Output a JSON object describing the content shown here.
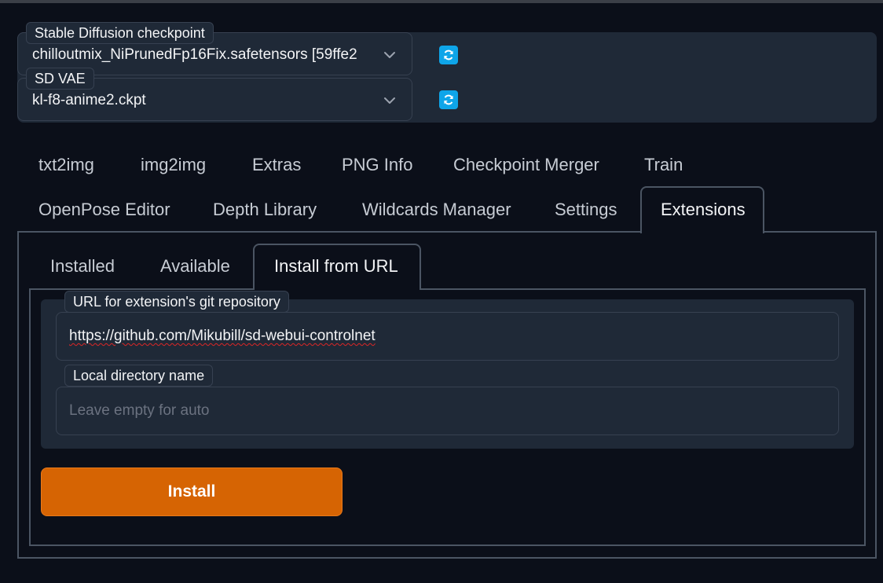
{
  "checkpoint": {
    "label": "Stable Diffusion checkpoint",
    "value": "chilloutmix_NiPrunedFp16Fix.safetensors [59ffe2"
  },
  "vae": {
    "label": "SD VAE",
    "value": "kl-f8-anime2.ckpt"
  },
  "icons": {
    "refresh": "refresh-icon",
    "dropdown": "chevron-down-icon"
  },
  "tabs_row1": [
    "txt2img",
    "img2img",
    "Extras",
    "PNG Info",
    "Checkpoint Merger",
    "Train"
  ],
  "tabs_row2": [
    "OpenPose Editor",
    "Depth Library",
    "Wildcards Manager",
    "Settings",
    "Extensions"
  ],
  "active_tab": "Extensions",
  "sub_tabs": [
    "Installed",
    "Available",
    "Install from URL"
  ],
  "active_sub_tab": "Install from URL",
  "form": {
    "url_label": "URL for extension's git repository",
    "url_value": "https://github.com/Mikubill/sd-webui-controlnet",
    "dir_label": "Local directory name",
    "dir_placeholder": "Leave empty for auto",
    "install_label": "Install"
  },
  "colors": {
    "background": "#0b0f19",
    "panel": "#1f2937",
    "accent_button": "#d66403",
    "refresh_button": "#0ea5e9"
  }
}
